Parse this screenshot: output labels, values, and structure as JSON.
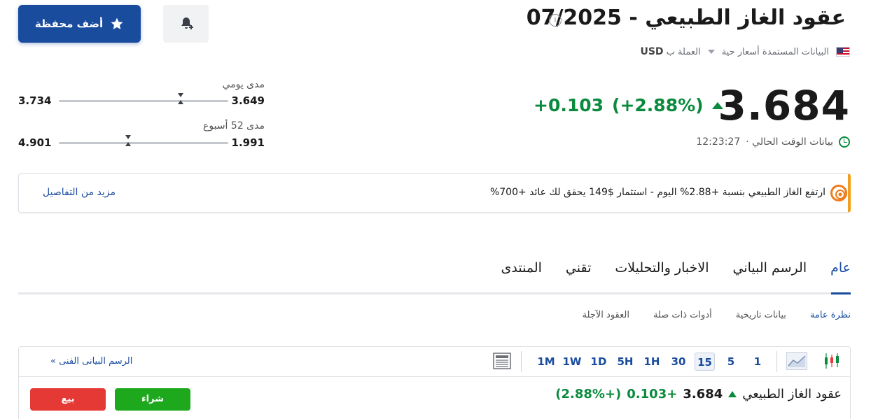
{
  "header": {
    "title": "عقود الغاز الطبيعي - 07/2025",
    "info_glyph": "i",
    "data_source": "البيانات المستمدة أسعار حية",
    "currency_label": "العملة ب",
    "currency": "USD"
  },
  "actions": {
    "add_portfolio": "أضف محفظة"
  },
  "quote": {
    "price": "3.684",
    "change": "+0.103",
    "change_pct": "(+2.88%)",
    "time_label": "بيانات الوقت الحالي ·",
    "time": "12:23:27"
  },
  "ranges": {
    "daily": {
      "label": "مدى يومي",
      "low": "3.649",
      "high": "3.734",
      "position": 0.28
    },
    "week52": {
      "label": "مدى 52 أسبوع",
      "low": "1.991",
      "high": "4.901",
      "position": 0.59
    }
  },
  "banner": {
    "text": "ارتفع الغاز الطبيعي بنسبة +2.88% اليوم - استثمار $149 يحقق لك عائد +700%",
    "link": "مزيد من التفاصيل"
  },
  "tabs": [
    "عام",
    "الرسم البياني",
    "الاخبار والتحليلات",
    "تقني",
    "المنتدى"
  ],
  "subtabs": [
    "نظرة عامة",
    "بيانات تاريخية",
    "أدوات ذات صلة",
    "العقود الآجلة"
  ],
  "chart_toolbar": {
    "timeframes": [
      "1",
      "5",
      "15",
      "30",
      "1H",
      "5H",
      "1D",
      "1W",
      "1M"
    ],
    "active": "15",
    "link": "الرسم البيانى الفنى »"
  },
  "ticker": {
    "name": "عقود الغاز الطبيعي",
    "price": "3.684",
    "change": "+0.103",
    "change_pct": "(+2.88%)",
    "buy": "شراء",
    "sell": "بيع"
  },
  "colors": {
    "brand_blue": "#1a4c9e",
    "positive": "#0a8a3d",
    "banner_accent": "#f0a01a",
    "buy": "#1ea81e",
    "sell": "#e53935"
  }
}
